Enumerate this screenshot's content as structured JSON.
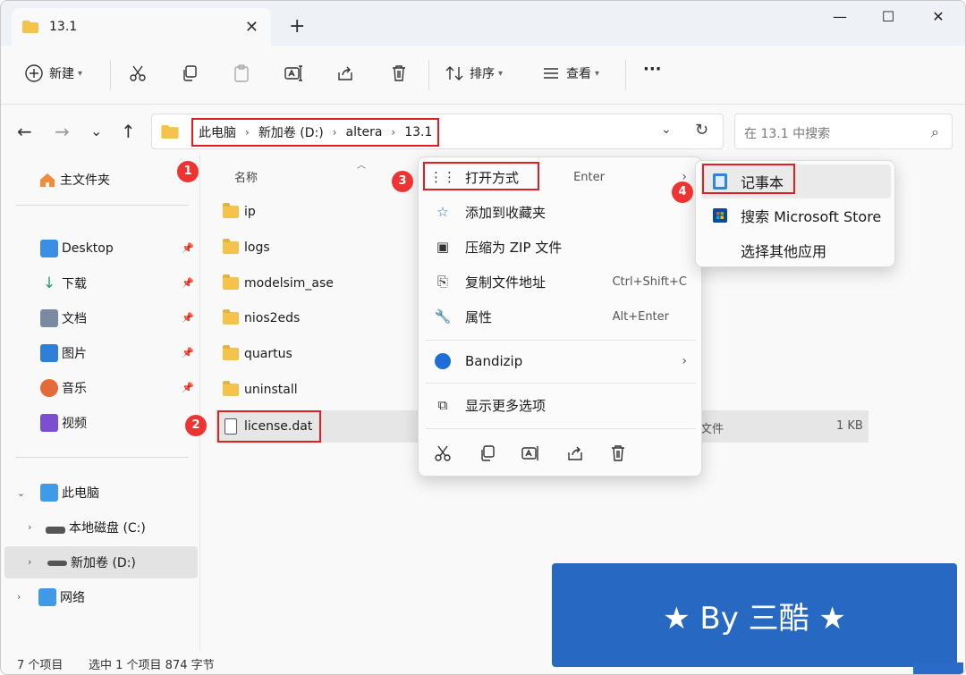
{
  "window": {
    "tab_title": "13.1",
    "tab_close": "✕",
    "new_tab": "+",
    "minimize": "—",
    "maximize": "☐",
    "close": "✕"
  },
  "toolbar": {
    "new_label": "新建",
    "sort_label": "排序",
    "view_label": "查看",
    "more": "···"
  },
  "nav": {
    "back": "←",
    "forward": "→",
    "recent": "⌄",
    "up": "↑",
    "breadcrumbs": [
      "此电脑",
      "新加卷 (D:)",
      "altera",
      "13.1"
    ],
    "search_placeholder": "在 13.1 中搜索"
  },
  "sidebar": {
    "home": "主文件夹",
    "pinned": [
      {
        "label": "Desktop",
        "color": "#3a8ee6"
      },
      {
        "label": "下载",
        "color": "#2aa06a"
      },
      {
        "label": "文档",
        "color": "#7a8aa0"
      },
      {
        "label": "图片",
        "color": "#2f7fd8"
      },
      {
        "label": "音乐",
        "color": "#e46a3a"
      },
      {
        "label": "视频",
        "color": "#7b4fd0"
      }
    ],
    "this_pc": "此电脑",
    "drive_c": "本地磁盘 (C:)",
    "drive_d": "新加卷 (D:)",
    "network": "网络"
  },
  "list": {
    "col_name": "名称",
    "folders": [
      "ip",
      "logs",
      "modelsim_ase",
      "nios2eds",
      "quartus",
      "uninstall"
    ],
    "file": {
      "name": "license.dat",
      "type": "文件",
      "size": "1 KB"
    }
  },
  "context_menu": {
    "items": [
      {
        "label": "打开方式",
        "shortcut": "Enter",
        "arrow": "›"
      },
      {
        "label": "添加到收藏夹",
        "shortcut": ""
      },
      {
        "label": "压缩为 ZIP 文件",
        "shortcut": ""
      },
      {
        "label": "复制文件地址",
        "shortcut": "Ctrl+Shift+C"
      },
      {
        "label": "属性",
        "shortcut": "Alt+Enter"
      },
      {
        "label": "Bandizip",
        "shortcut": "",
        "arrow": "›"
      },
      {
        "label": "显示更多选项",
        "shortcut": ""
      }
    ]
  },
  "submenu": {
    "items": [
      "记事本",
      "搜索 Microsoft Store",
      "选择其他应用"
    ]
  },
  "badges": [
    "1",
    "2",
    "3",
    "4"
  ],
  "status": {
    "count": "7 个项目",
    "selection": "选中 1 个项目 874 字节"
  },
  "banner": "★ By 三酷 ★"
}
